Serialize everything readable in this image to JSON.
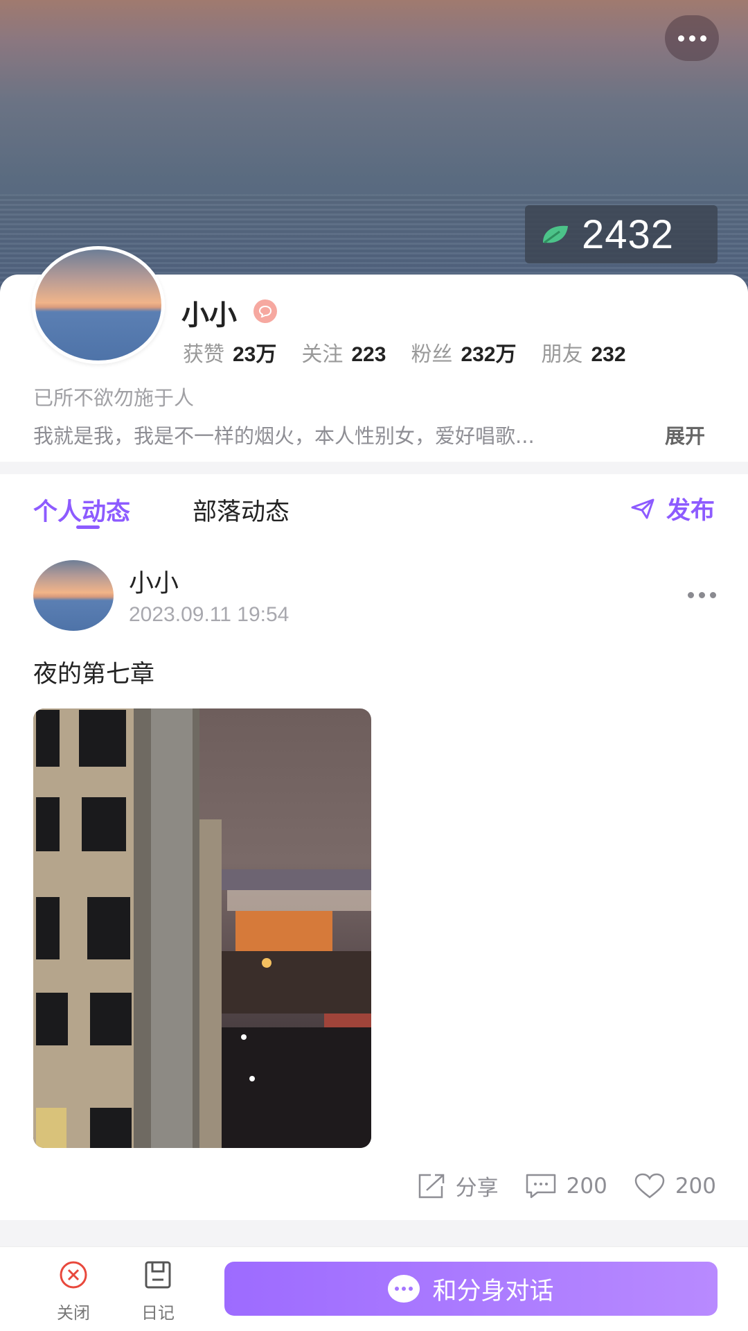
{
  "profile": {
    "score": "2432",
    "name": "小小",
    "stats": [
      {
        "label": "获赞",
        "value": "23万"
      },
      {
        "label": "关注",
        "value": "223"
      },
      {
        "label": "粉丝",
        "value": "232万"
      },
      {
        "label": "朋友",
        "value": "232"
      }
    ],
    "signature": "已所不欲勿施于人",
    "bio": "我就是我，我是不一样的烟火，本人性别女，爱好唱歌...",
    "expand_label": "展开"
  },
  "tabs": [
    {
      "label": "个人动态",
      "active": true
    },
    {
      "label": "部落动态",
      "active": false
    }
  ],
  "publish_label": "发布",
  "post": {
    "author": "小小",
    "time": "2023.09.11 19:54",
    "text": "夜的第七章",
    "share_label": "分享",
    "comment_count": "200",
    "like_count": "200"
  },
  "bottom_bar": {
    "close_label": "关闭",
    "diary_label": "日记",
    "chat_label": "和分身对话"
  },
  "colors": {
    "accent": "#8d5bff",
    "leaf": "#4cc389"
  }
}
